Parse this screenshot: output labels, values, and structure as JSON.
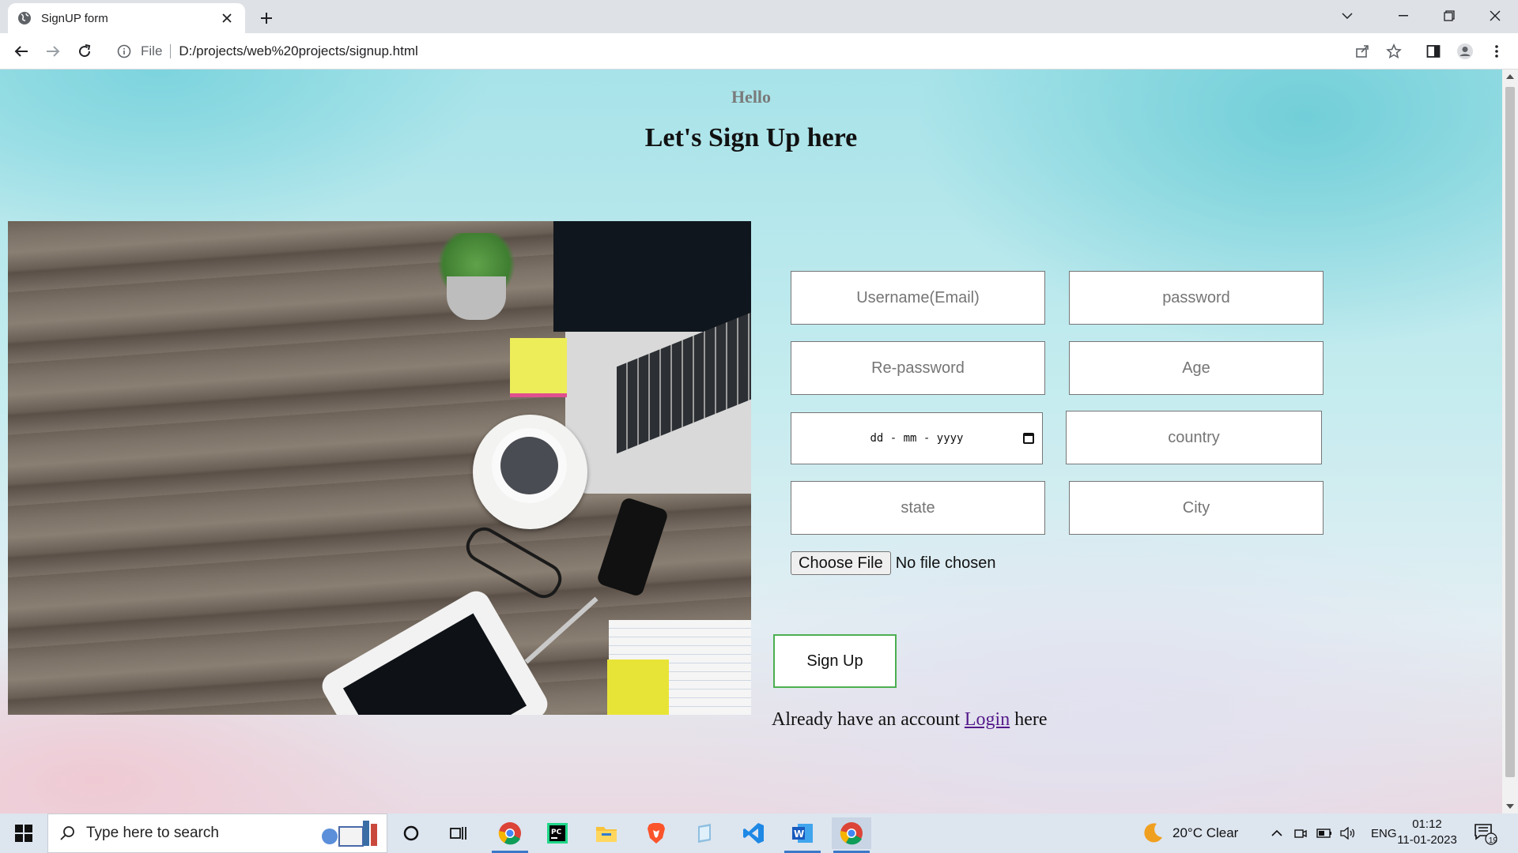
{
  "browser": {
    "tab_title": "SignUP form",
    "address_scheme": "File",
    "address_url": "D:/projects/web%20projects/signup.html"
  },
  "page": {
    "greeting": "Hello",
    "heading": "Let's Sign Up here",
    "photo_alt": "",
    "fields": {
      "username_placeholder": "Username(Email)",
      "password_placeholder": "password",
      "repassword_placeholder": "Re-password",
      "age_placeholder": "Age",
      "date_placeholder": "dd - mm - yyyy",
      "country_placeholder": "country",
      "state_placeholder": "state",
      "city_placeholder": "City"
    },
    "file_input": {
      "button_label": "Choose File",
      "status": "No file chosen"
    },
    "signup_button": "Sign Up",
    "login_prompt": {
      "before": "Already have an account ",
      "link": "Login",
      "after": " here"
    },
    "colors": {
      "signup_border": "#4caf50",
      "link": "#551a8b"
    }
  },
  "taskbar": {
    "search_placeholder": "Type here to search",
    "weather": "20°C  Clear",
    "language": "ENG",
    "time": "01:12",
    "date": "11-01-2023",
    "notification_count": "19",
    "apps": [
      "cortana-icon",
      "task-view-icon",
      "chrome-icon",
      "pycharm-icon",
      "file-explorer-icon",
      "brave-icon",
      "notepad-icon",
      "vscode-icon",
      "word-icon",
      "chrome-active-icon"
    ]
  }
}
